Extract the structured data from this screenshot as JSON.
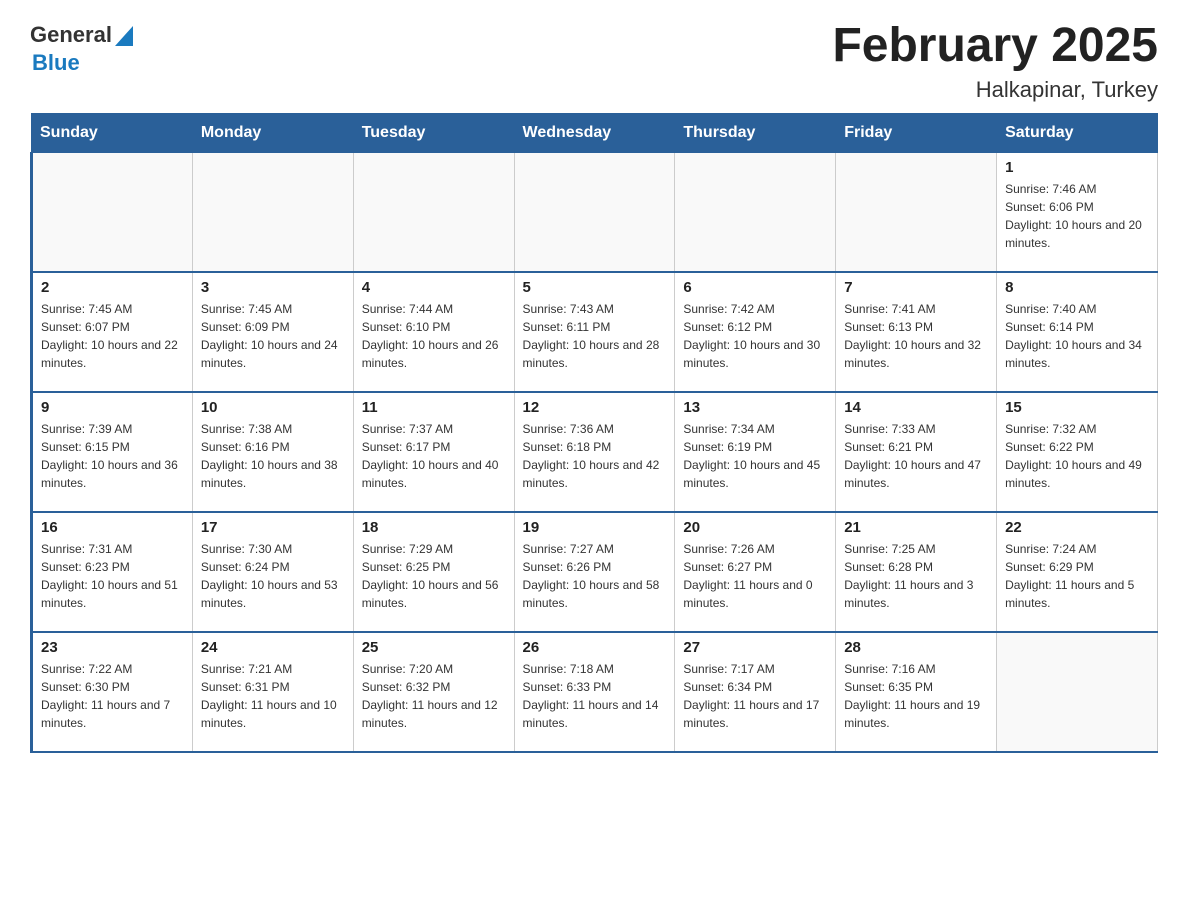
{
  "header": {
    "logo_text_general": "General",
    "logo_text_blue": "Blue",
    "page_title": "February 2025",
    "subtitle": "Halkapinar, Turkey"
  },
  "days_of_week": [
    "Sunday",
    "Monday",
    "Tuesday",
    "Wednesday",
    "Thursday",
    "Friday",
    "Saturday"
  ],
  "weeks": [
    [
      {
        "day": "",
        "info": ""
      },
      {
        "day": "",
        "info": ""
      },
      {
        "day": "",
        "info": ""
      },
      {
        "day": "",
        "info": ""
      },
      {
        "day": "",
        "info": ""
      },
      {
        "day": "",
        "info": ""
      },
      {
        "day": "1",
        "info": "Sunrise: 7:46 AM\nSunset: 6:06 PM\nDaylight: 10 hours and 20 minutes."
      }
    ],
    [
      {
        "day": "2",
        "info": "Sunrise: 7:45 AM\nSunset: 6:07 PM\nDaylight: 10 hours and 22 minutes."
      },
      {
        "day": "3",
        "info": "Sunrise: 7:45 AM\nSunset: 6:09 PM\nDaylight: 10 hours and 24 minutes."
      },
      {
        "day": "4",
        "info": "Sunrise: 7:44 AM\nSunset: 6:10 PM\nDaylight: 10 hours and 26 minutes."
      },
      {
        "day": "5",
        "info": "Sunrise: 7:43 AM\nSunset: 6:11 PM\nDaylight: 10 hours and 28 minutes."
      },
      {
        "day": "6",
        "info": "Sunrise: 7:42 AM\nSunset: 6:12 PM\nDaylight: 10 hours and 30 minutes."
      },
      {
        "day": "7",
        "info": "Sunrise: 7:41 AM\nSunset: 6:13 PM\nDaylight: 10 hours and 32 minutes."
      },
      {
        "day": "8",
        "info": "Sunrise: 7:40 AM\nSunset: 6:14 PM\nDaylight: 10 hours and 34 minutes."
      }
    ],
    [
      {
        "day": "9",
        "info": "Sunrise: 7:39 AM\nSunset: 6:15 PM\nDaylight: 10 hours and 36 minutes."
      },
      {
        "day": "10",
        "info": "Sunrise: 7:38 AM\nSunset: 6:16 PM\nDaylight: 10 hours and 38 minutes."
      },
      {
        "day": "11",
        "info": "Sunrise: 7:37 AM\nSunset: 6:17 PM\nDaylight: 10 hours and 40 minutes."
      },
      {
        "day": "12",
        "info": "Sunrise: 7:36 AM\nSunset: 6:18 PM\nDaylight: 10 hours and 42 minutes."
      },
      {
        "day": "13",
        "info": "Sunrise: 7:34 AM\nSunset: 6:19 PM\nDaylight: 10 hours and 45 minutes."
      },
      {
        "day": "14",
        "info": "Sunrise: 7:33 AM\nSunset: 6:21 PM\nDaylight: 10 hours and 47 minutes."
      },
      {
        "day": "15",
        "info": "Sunrise: 7:32 AM\nSunset: 6:22 PM\nDaylight: 10 hours and 49 minutes."
      }
    ],
    [
      {
        "day": "16",
        "info": "Sunrise: 7:31 AM\nSunset: 6:23 PM\nDaylight: 10 hours and 51 minutes."
      },
      {
        "day": "17",
        "info": "Sunrise: 7:30 AM\nSunset: 6:24 PM\nDaylight: 10 hours and 53 minutes."
      },
      {
        "day": "18",
        "info": "Sunrise: 7:29 AM\nSunset: 6:25 PM\nDaylight: 10 hours and 56 minutes."
      },
      {
        "day": "19",
        "info": "Sunrise: 7:27 AM\nSunset: 6:26 PM\nDaylight: 10 hours and 58 minutes."
      },
      {
        "day": "20",
        "info": "Sunrise: 7:26 AM\nSunset: 6:27 PM\nDaylight: 11 hours and 0 minutes."
      },
      {
        "day": "21",
        "info": "Sunrise: 7:25 AM\nSunset: 6:28 PM\nDaylight: 11 hours and 3 minutes."
      },
      {
        "day": "22",
        "info": "Sunrise: 7:24 AM\nSunset: 6:29 PM\nDaylight: 11 hours and 5 minutes."
      }
    ],
    [
      {
        "day": "23",
        "info": "Sunrise: 7:22 AM\nSunset: 6:30 PM\nDaylight: 11 hours and 7 minutes."
      },
      {
        "day": "24",
        "info": "Sunrise: 7:21 AM\nSunset: 6:31 PM\nDaylight: 11 hours and 10 minutes."
      },
      {
        "day": "25",
        "info": "Sunrise: 7:20 AM\nSunset: 6:32 PM\nDaylight: 11 hours and 12 minutes."
      },
      {
        "day": "26",
        "info": "Sunrise: 7:18 AM\nSunset: 6:33 PM\nDaylight: 11 hours and 14 minutes."
      },
      {
        "day": "27",
        "info": "Sunrise: 7:17 AM\nSunset: 6:34 PM\nDaylight: 11 hours and 17 minutes."
      },
      {
        "day": "28",
        "info": "Sunrise: 7:16 AM\nSunset: 6:35 PM\nDaylight: 11 hours and 19 minutes."
      },
      {
        "day": "",
        "info": ""
      }
    ]
  ]
}
